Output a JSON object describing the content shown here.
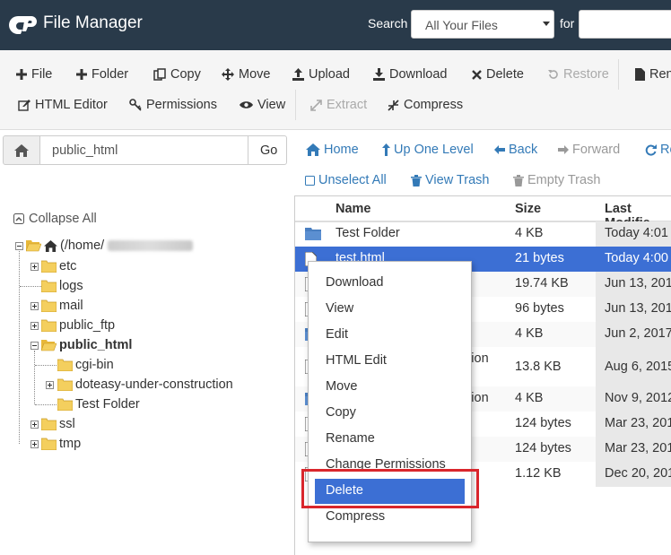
{
  "header": {
    "app_title": "File Manager",
    "search_label": "Search",
    "search_scope": "All Your Files",
    "for_label": "for"
  },
  "toolbar": {
    "row1": [
      {
        "label": "File",
        "icon": "plus-icon",
        "enabled": true
      },
      {
        "label": "Folder",
        "icon": "plus-icon",
        "enabled": true
      },
      {
        "label": "Copy",
        "icon": "copy-icon",
        "enabled": true
      },
      {
        "label": "Move",
        "icon": "move-icon",
        "enabled": true
      },
      {
        "label": "Upload",
        "icon": "upload-icon",
        "enabled": true
      },
      {
        "label": "Download",
        "icon": "download-icon",
        "enabled": true
      },
      {
        "label": "Delete",
        "icon": "close-icon",
        "enabled": true
      },
      {
        "label": "Restore",
        "icon": "restore-icon",
        "enabled": false
      },
      {
        "label": "Ren",
        "icon": "file-icon",
        "enabled": true
      }
    ],
    "row2": [
      {
        "label": "HTML Editor",
        "icon": "edit-icon",
        "enabled": true
      },
      {
        "label": "Permissions",
        "icon": "key-icon",
        "enabled": true
      },
      {
        "label": "View",
        "icon": "eye-icon",
        "enabled": true
      },
      {
        "label": "Extract",
        "icon": "expand-icon",
        "enabled": false
      },
      {
        "label": "Compress",
        "icon": "compress-icon",
        "enabled": true
      }
    ]
  },
  "path_bar": {
    "value": "public_html",
    "go_label": "Go"
  },
  "nav": {
    "home": "Home",
    "up": "Up One Level",
    "back": "Back",
    "forward": "Forward",
    "reload": "Re",
    "unselect_all": "Unselect All",
    "view_trash": "View Trash",
    "empty_trash": "Empty Trash"
  },
  "tree": {
    "collapse_all": "Collapse All",
    "root": "(/home/",
    "nodes": [
      "etc",
      "logs",
      "mail",
      "public_ftp",
      "public_html",
      "cgi-bin",
      "doteasy-under-construction",
      "Test Folder",
      "ssl",
      "tmp"
    ]
  },
  "table": {
    "columns": [
      "Name",
      "Size",
      "Last Modifie"
    ],
    "rows": [
      {
        "name": "Test Folder",
        "size": "4 KB",
        "modified": "Today 4:01",
        "type": "folder"
      },
      {
        "name": "test.html",
        "size": "21 bytes",
        "modified": "Today 4:00",
        "type": "file",
        "selected": true
      },
      {
        "name": "",
        "size": "19.74 KB",
        "modified": "Jun 13, 201",
        "type": "file"
      },
      {
        "name": "",
        "size": "96 bytes",
        "modified": "Jun 13, 201",
        "type": "file"
      },
      {
        "name": "",
        "size": "4 KB",
        "modified": "Jun 2, 2017",
        "type": "file"
      },
      {
        "name": "ction",
        "size": "13.8 KB",
        "modified": "Aug 6, 2015",
        "type": "file"
      },
      {
        "name": "ction",
        "size": "4 KB",
        "modified": "Nov 9, 2012",
        "type": "file"
      },
      {
        "name": "",
        "size": "124 bytes",
        "modified": "Mar 23, 201",
        "type": "file"
      },
      {
        "name": "",
        "size": "124 bytes",
        "modified": "Mar 23, 201",
        "type": "file"
      },
      {
        "name": "",
        "size": "1.12 KB",
        "modified": "Dec 20, 201",
        "type": "file"
      }
    ]
  },
  "context_menu": {
    "items": [
      "Download",
      "View",
      "Edit",
      "HTML Edit",
      "Move",
      "Copy",
      "Rename",
      "Change Permissions",
      "Delete",
      "Compress"
    ],
    "highlighted": "Delete"
  },
  "colors": {
    "header_bg": "#293a4a",
    "link": "#337ab7",
    "selection": "#3c6fd4",
    "callout": "#d9262c"
  }
}
